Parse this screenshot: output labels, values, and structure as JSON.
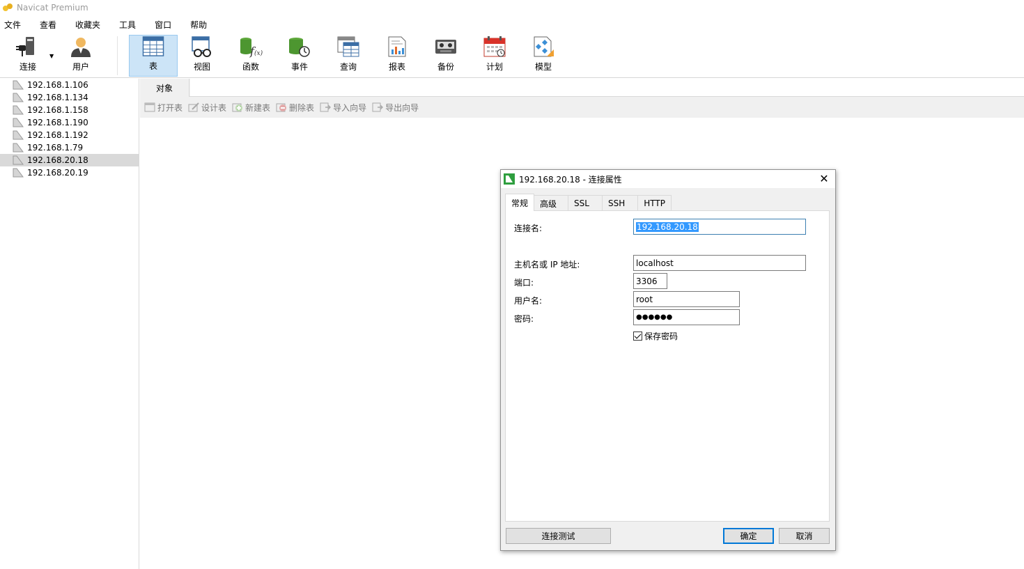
{
  "window": {
    "title": "Navicat Premium"
  },
  "menu": [
    "文件",
    "查看",
    "收藏夹",
    "工具",
    "窗口",
    "帮助"
  ],
  "toolbar": {
    "connect": "连接",
    "user": "用户",
    "table": "表",
    "view": "视图",
    "function": "函数",
    "event": "事件",
    "query": "查询",
    "report": "报表",
    "backup": "备份",
    "schedule": "计划",
    "model": "模型",
    "active": "table"
  },
  "connections": [
    "192.168.1.106",
    "192.168.1.134",
    "192.168.1.158",
    "192.168.1.190",
    "192.168.1.192",
    "192.168.1.79",
    "192.168.20.18",
    "192.168.20.19"
  ],
  "selected_connection": "192.168.20.18",
  "objects_tab": "对象",
  "object_actions": [
    "打开表",
    "设计表",
    "新建表",
    "删除表",
    "导入向导",
    "导出向导"
  ],
  "dialog": {
    "title": "192.168.20.18 - 连接属性",
    "tabs": [
      "常规",
      "高级",
      "SSL",
      "SSH",
      "HTTP"
    ],
    "active_tab": "常规",
    "fields": {
      "conn_name_label": "连接名:",
      "conn_name_value": "192.168.20.18",
      "host_label": "主机名或 IP 地址:",
      "host_value": "localhost",
      "port_label": "端口:",
      "port_value": "3306",
      "user_label": "用户名:",
      "user_value": "root",
      "password_label": "密码:",
      "password_value": "●●●●●●",
      "save_password_label": "保存密码",
      "save_password_checked": true
    },
    "buttons": {
      "test": "连接测试",
      "ok": "确定",
      "cancel": "取消"
    }
  },
  "colors": {
    "selection": "#3399ff",
    "active_tool": "#cce4f7",
    "default_button_border": "#0078d7"
  }
}
